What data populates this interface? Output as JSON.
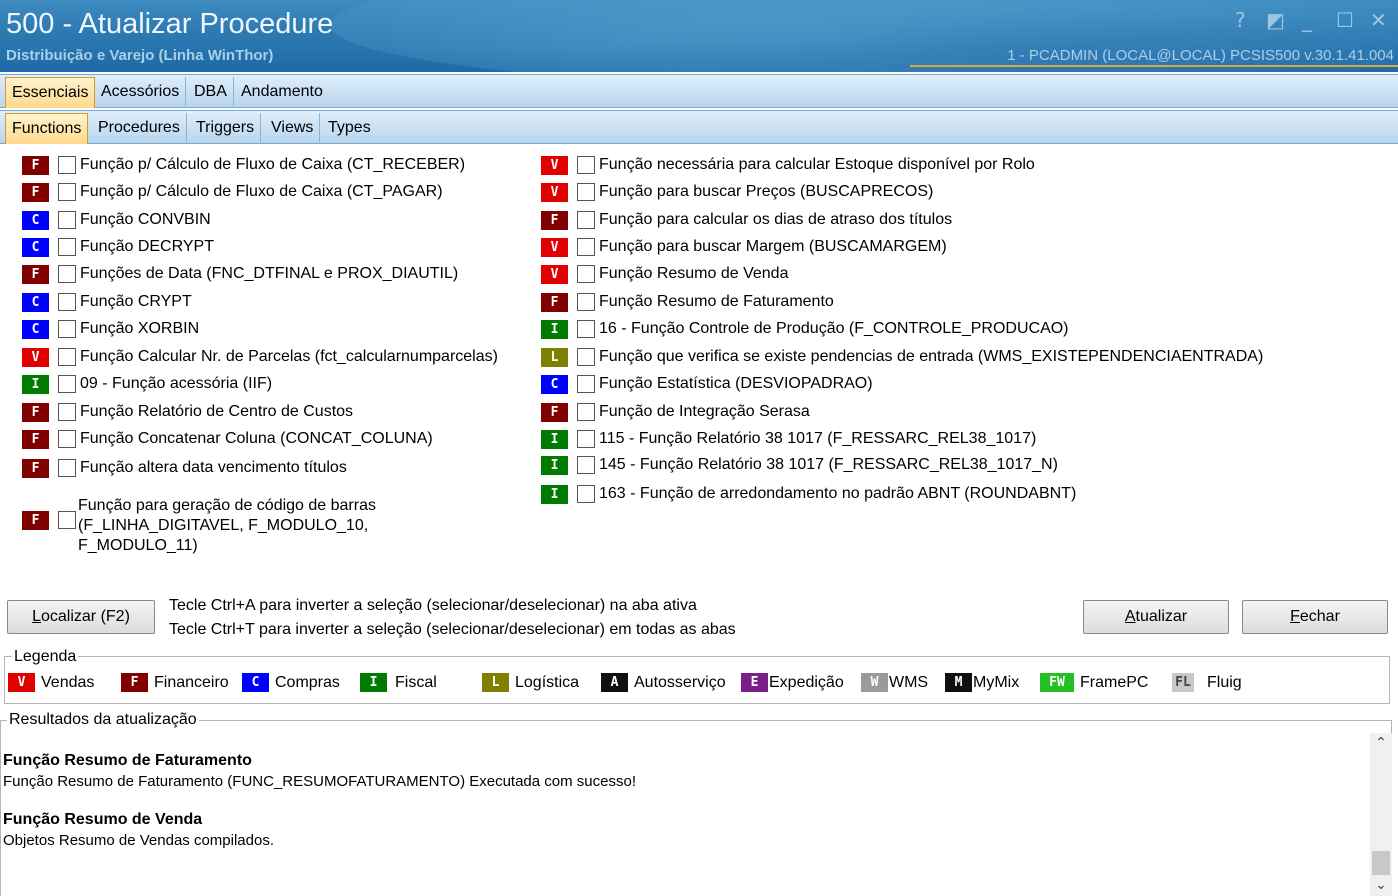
{
  "window": {
    "title": "500 - Atualizar Procedure",
    "subtitle": "Distribuição e Varejo (Linha WinThor)",
    "connection": "1 - PCADMIN (LOCAL@LOCAL)   PCSIS500  v.30.1.41.004",
    "controls": {
      "help": "?",
      "restore": "◩",
      "minimize": "_",
      "maximize": "☐",
      "close": "✕"
    }
  },
  "main_tabs": [
    "Essenciais",
    "Acessórios",
    "DBA",
    "Andamento"
  ],
  "sub_tabs": [
    "Functions",
    "Procedures",
    "Triggers",
    "Views",
    "Types"
  ],
  "badge_colors": {
    "V": "#e00000",
    "F": "#800000",
    "C": "#0000ff",
    "I": "#007a00",
    "L": "#808000",
    "A": "#101010",
    "E": "#7a1f8a",
    "W": "#9a9a9a",
    "M": "#101010",
    "FW": "#22c022",
    "FL": "#c8c8c8"
  },
  "functions_left": [
    {
      "badge": "F",
      "label": "Função p/ Cálculo de Fluxo de Caixa (CT_RECEBER)"
    },
    {
      "badge": "F",
      "label": "Função p/ Cálculo de Fluxo de Caixa (CT_PAGAR)"
    },
    {
      "badge": "C",
      "label": "Função CONVBIN"
    },
    {
      "badge": "C",
      "label": "Função DECRYPT"
    },
    {
      "badge": "F",
      "label": "Funções de Data (FNC_DTFINAL e PROX_DIAUTIL)"
    },
    {
      "badge": "C",
      "label": "Função CRYPT"
    },
    {
      "badge": "C",
      "label": "Função XORBIN"
    },
    {
      "badge": "V",
      "label": "Função Calcular Nr. de Parcelas (fct_calcularnumparcelas)"
    },
    {
      "badge": "I",
      "label": "09 - Função acessória (IIF)"
    },
    {
      "badge": "F",
      "label": "Função Relatório de Centro de Custos"
    },
    {
      "badge": "F",
      "label": "Função Concatenar Coluna (CONCAT_COLUNA)"
    },
    {
      "badge": "F",
      "label": "Função altera data vencimento títulos"
    }
  ],
  "function_barcode": {
    "badge": "F",
    "line1": "Função para geração de código de barras",
    "line2": "(F_LINHA_DIGITAVEL, F_MODULO_10,",
    "line3": "F_MODULO_11)"
  },
  "functions_right": [
    {
      "badge": "V",
      "label": "Função necessária para calcular Estoque disponível por Rolo"
    },
    {
      "badge": "V",
      "label": "Função para buscar Preços (BUSCAPRECOS)"
    },
    {
      "badge": "F",
      "label": "Função para calcular os dias de atraso dos títulos"
    },
    {
      "badge": "V",
      "label": "Função para buscar Margem (BUSCAMARGEM)"
    },
    {
      "badge": "V",
      "label": "Função Resumo de Venda"
    },
    {
      "badge": "F",
      "label": "Função Resumo de Faturamento"
    },
    {
      "badge": "I",
      "label": "16 - Função Controle de Produção (F_CONTROLE_PRODUCAO)"
    },
    {
      "badge": "L",
      "label": "Função que verifica se existe pendencias de entrada (WMS_EXISTEPENDENCIAENTRADA)"
    },
    {
      "badge": "C",
      "label": "Função Estatística (DESVIOPADRAO)"
    },
    {
      "badge": "F",
      "label": "Função de Integração Serasa"
    },
    {
      "badge": "I",
      "label": "115 - Função Relatório 38 1017 (F_RESSARC_REL38_1017)"
    },
    {
      "badge": "I",
      "label": "145 - Função Relatório 38 1017 (F_RESSARC_REL38_1017_N)"
    },
    {
      "badge": "I",
      "label": "163 - Função de arredondamento no padrão ABNT (ROUNDABNT)"
    }
  ],
  "actions": {
    "localizar_u": "L",
    "localizar_rest": "ocalizar (F2)",
    "hint1": "Tecle Ctrl+A para inverter a seleção (selecionar/deselecionar) na aba ativa",
    "hint2": "Tecle Ctrl+T para inverter a seleção (selecionar/deselecionar) em todas as abas",
    "atualizar_u": "A",
    "atualizar_rest": "tualizar",
    "fechar_u": "F",
    "fechar_rest": "echar"
  },
  "legend": {
    "title": "Legenda",
    "items": [
      {
        "badge": "V",
        "label": "Vendas"
      },
      {
        "badge": "F",
        "label": "Financeiro"
      },
      {
        "badge": "C",
        "label": "Compras"
      },
      {
        "badge": "I",
        "label": "Fiscal"
      },
      {
        "badge": "L",
        "label": "Logística"
      },
      {
        "badge": "A",
        "label": "Autosserviço"
      },
      {
        "badge": "E",
        "label": "Expedição"
      },
      {
        "badge": "W",
        "label": "WMS"
      },
      {
        "badge": "M",
        "label": "MyMix"
      },
      {
        "badge": "FW",
        "label": "FramePC"
      },
      {
        "badge": "FL",
        "label": "Fluig"
      }
    ]
  },
  "results": {
    "title": "Resultados da atualização",
    "entries": [
      {
        "title": "Função Resumo de Faturamento",
        "message": "Função Resumo de Faturamento (FUNC_RESUMOFATURAMENTO) Executada com sucesso!"
      },
      {
        "title": "Função Resumo de Venda",
        "message": "Objetos Resumo de Vendas compilados."
      }
    ]
  }
}
